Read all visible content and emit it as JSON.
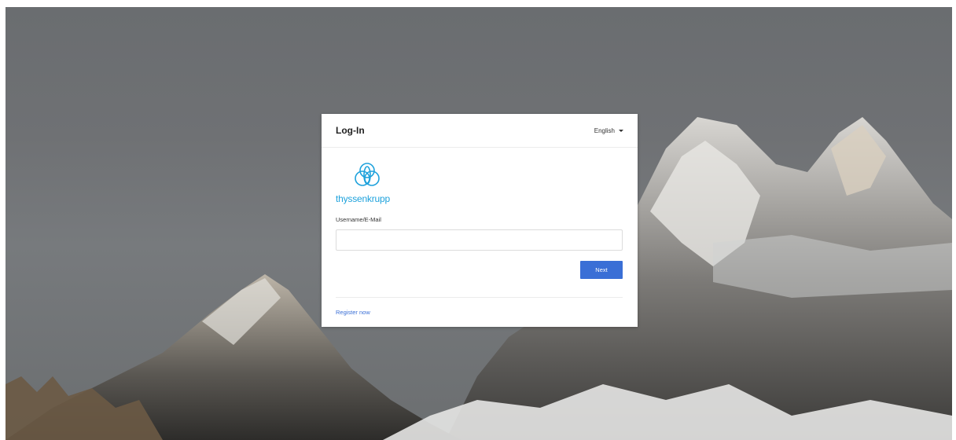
{
  "page": {
    "background": "mountain-landscape-photo"
  },
  "card": {
    "title": "Log-In",
    "language": "English",
    "logo_text": "thyssenkrupp",
    "username_label": "Username/E-Mail",
    "username_value": "",
    "username_placeholder": "",
    "next_label": "Next",
    "register_label": "Register now"
  },
  "colors": {
    "accent": "#3a6fd6",
    "brand": "#1fa2dc"
  }
}
